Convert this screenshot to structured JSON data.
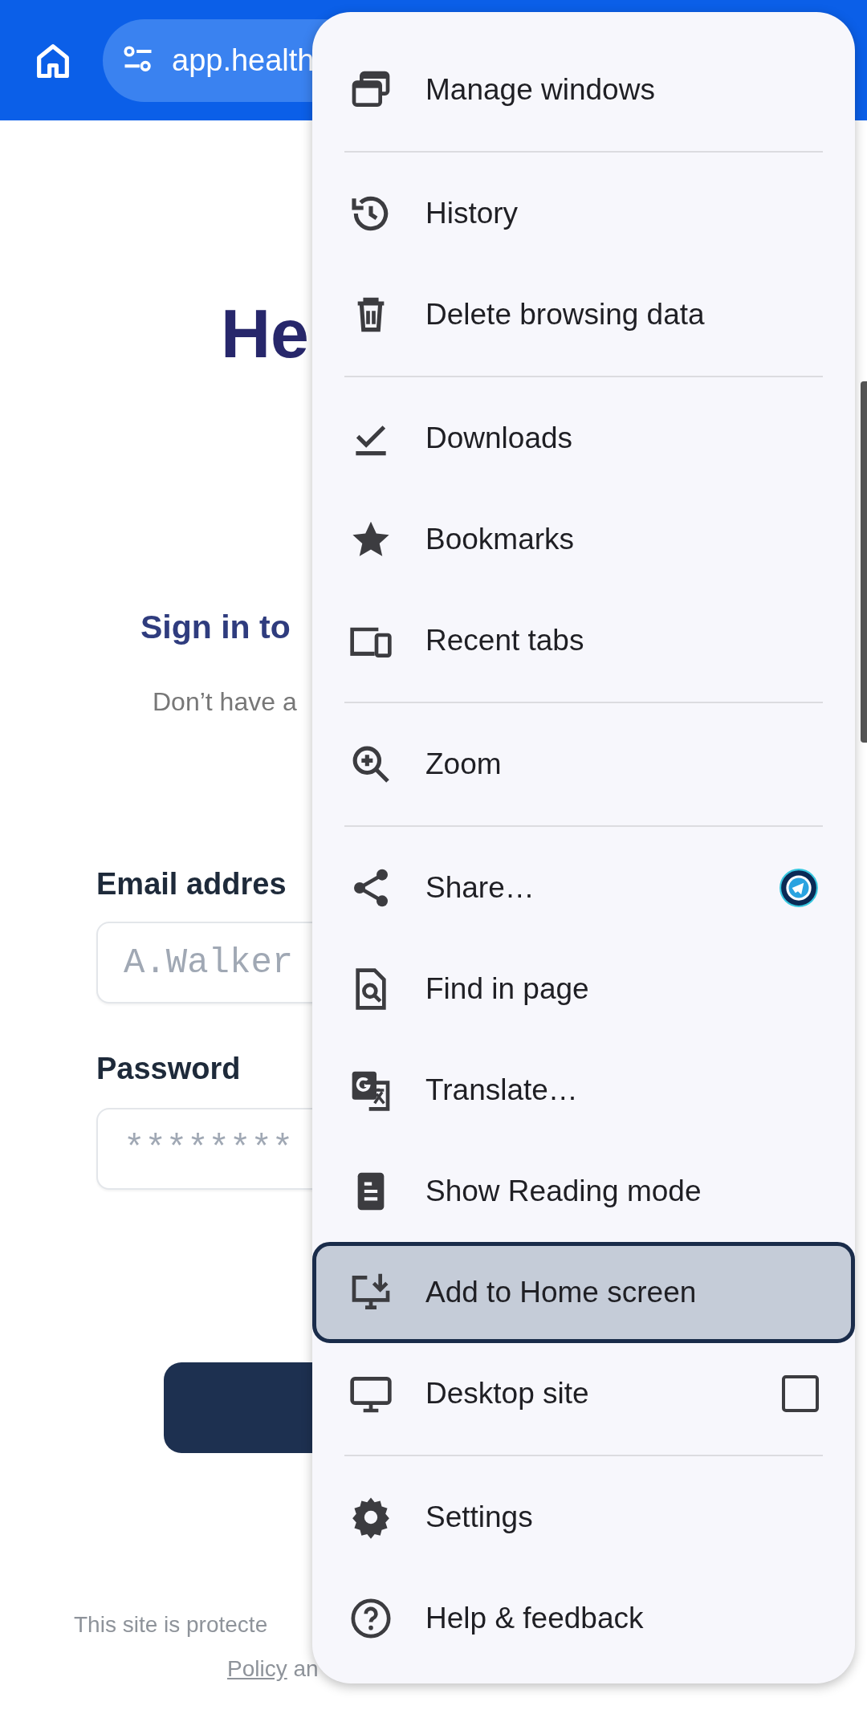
{
  "toolbar": {
    "url": "app.health"
  },
  "page": {
    "heading": "He",
    "subheading": "Sign in to",
    "signup_prompt": "Don’t have a",
    "email_label": "Email addres",
    "email_placeholder": "A.Walker",
    "password_label": "Password",
    "password_placeholder": "********",
    "footer_line": "This site is protecte",
    "footer_link": "Policy",
    "footer_rest": "an"
  },
  "menu": {
    "sections": [
      {
        "items": [
          {
            "label": "Manage windows",
            "kind": "plain",
            "highlighted": false
          }
        ]
      },
      {
        "items": [
          {
            "label": "History",
            "kind": "plain",
            "highlighted": false
          },
          {
            "label": "Delete browsing data",
            "kind": "plain",
            "highlighted": false
          }
        ]
      },
      {
        "items": [
          {
            "label": "Downloads",
            "kind": "plain",
            "highlighted": false
          },
          {
            "label": "Bookmarks",
            "kind": "plain",
            "highlighted": false
          },
          {
            "label": "Recent tabs",
            "kind": "plain",
            "highlighted": false
          }
        ]
      },
      {
        "items": [
          {
            "label": "Zoom",
            "kind": "plain",
            "highlighted": false
          }
        ]
      },
      {
        "items": [
          {
            "label": "Share…",
            "kind": "share",
            "highlighted": false
          },
          {
            "label": "Find in page",
            "kind": "plain",
            "highlighted": false
          },
          {
            "label": "Translate…",
            "kind": "plain",
            "highlighted": false
          },
          {
            "label": "Show Reading mode",
            "kind": "plain",
            "highlighted": false
          },
          {
            "label": "Add to Home screen",
            "kind": "plain",
            "highlighted": true
          },
          {
            "label": "Desktop site",
            "kind": "checkbox",
            "checked": false,
            "highlighted": false
          }
        ]
      },
      {
        "items": [
          {
            "label": "Settings",
            "kind": "plain",
            "highlighted": false
          },
          {
            "label": "Help & feedback",
            "kind": "plain",
            "highlighted": false
          }
        ]
      }
    ]
  }
}
